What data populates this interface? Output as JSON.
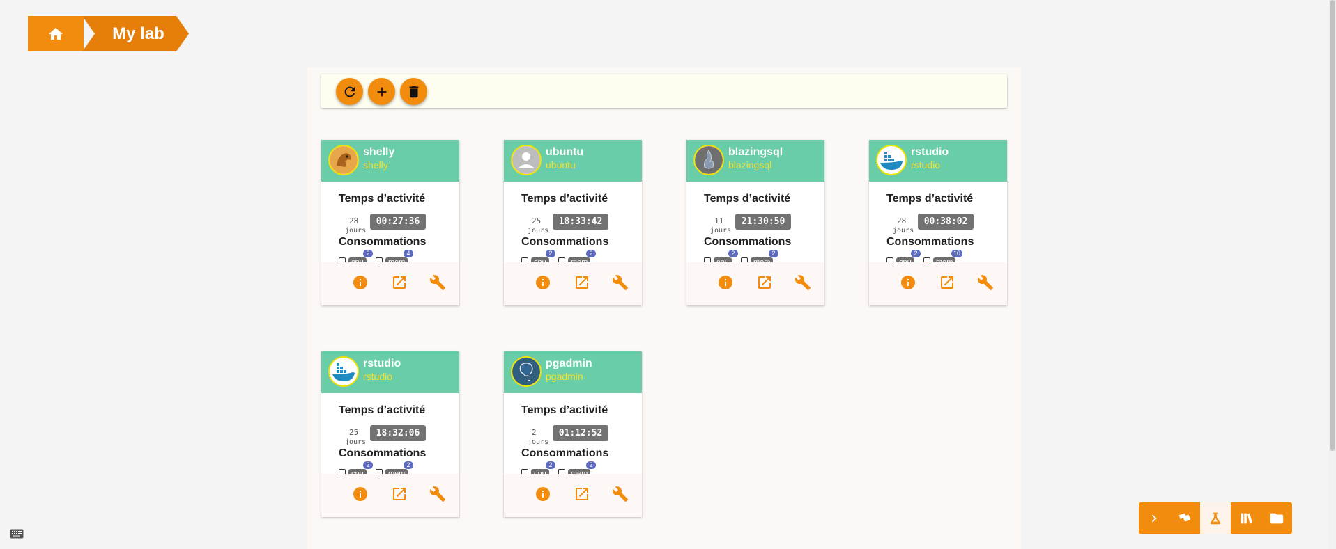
{
  "breadcrumb": {
    "home_icon": "home-icon",
    "current": "My lab"
  },
  "toolbar": {
    "buttons": [
      {
        "icon": "refresh-icon"
      },
      {
        "icon": "add-icon"
      },
      {
        "icon": "trash-icon"
      }
    ]
  },
  "labels": {
    "activity": "Temps d’activité",
    "consumption": "Consommations",
    "days": "jours",
    "cpu": "cpu",
    "mem": "mem"
  },
  "services": [
    {
      "name": "shelly",
      "subtitle": "shelly",
      "avatar": "shelly-logo-icon",
      "days": "28",
      "time": "00:27:36",
      "cpu_count": "2",
      "mem_count": "4",
      "mem_alert": false
    },
    {
      "name": "ubuntu",
      "subtitle": "ubuntu",
      "avatar": "user-placeholder-icon",
      "days": "25",
      "time": "18:33:42",
      "cpu_count": "2",
      "mem_count": "2",
      "mem_alert": false
    },
    {
      "name": "blazingsql",
      "subtitle": "blazingsql",
      "avatar": "blazingsql-logo-icon",
      "days": "11",
      "time": "21:30:50",
      "cpu_count": "2",
      "mem_count": "2",
      "mem_alert": false
    },
    {
      "name": "rstudio",
      "subtitle": "rstudio",
      "avatar": "docker-whale-icon",
      "days": "28",
      "time": "00:38:02",
      "cpu_count": "2",
      "mem_count": "10",
      "mem_alert": true
    },
    {
      "name": "rstudio",
      "subtitle": "rstudio",
      "avatar": "docker-whale-icon",
      "days": "25",
      "time": "18:32:06",
      "cpu_count": "2",
      "mem_count": "2",
      "mem_alert": false
    },
    {
      "name": "pgadmin",
      "subtitle": "pgadmin",
      "avatar": "postgres-elephant-icon",
      "days": "2",
      "time": "01:12:52",
      "cpu_count": "2",
      "mem_count": "2",
      "mem_alert": false
    }
  ],
  "bottom_nav": [
    {
      "icon": "chevron-right-icon",
      "active": false
    },
    {
      "icon": "catalog-cards-icon",
      "active": false
    },
    {
      "icon": "flask-icon",
      "active": true
    },
    {
      "icon": "books-icon",
      "active": false
    },
    {
      "icon": "folder-icon",
      "active": false
    }
  ],
  "colors": {
    "accent": "#f28c0f",
    "card_header": "#69cea8",
    "subtitle": "#f6e028",
    "badge": "#5c6bc0"
  }
}
